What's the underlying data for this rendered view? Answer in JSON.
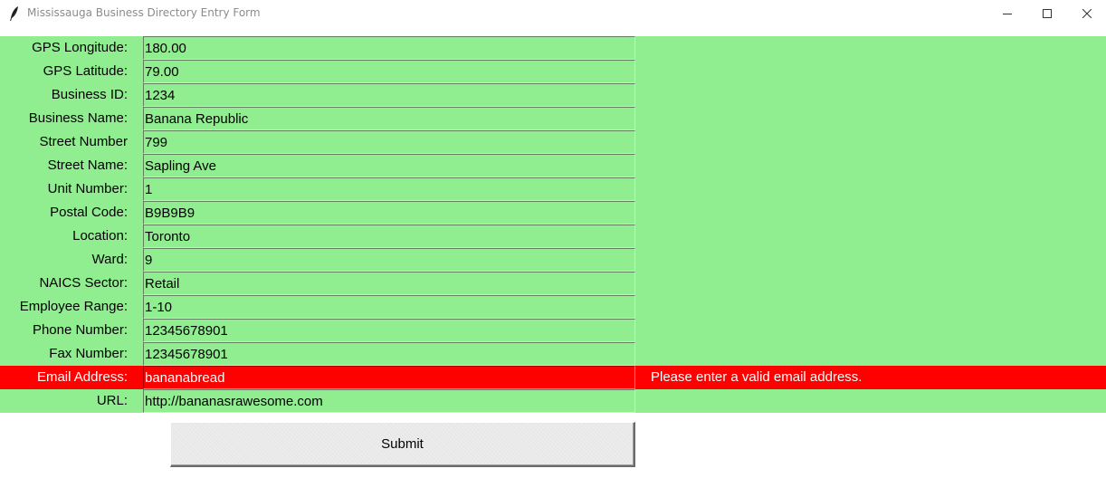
{
  "window": {
    "title": "Mississauga Business Directory Entry Form",
    "icon": "feather-icon",
    "controls": [
      "minimize-icon",
      "maximize-icon",
      "close-icon"
    ]
  },
  "colors": {
    "form_background": "#90ee90",
    "error_background": "#ff0000",
    "error_text": "#ffffff"
  },
  "fields": [
    {
      "label": "GPS Longitude:",
      "value": "180.00"
    },
    {
      "label": "GPS Latitude:",
      "value": "79.00"
    },
    {
      "label": "Business ID:",
      "value": "1234"
    },
    {
      "label": "Business Name:",
      "value": "Banana Republic"
    },
    {
      "label": "Street Number",
      "value": "799"
    },
    {
      "label": "Street Name:",
      "value": "Sapling Ave"
    },
    {
      "label": "Unit Number:",
      "value": "1"
    },
    {
      "label": "Postal Code:",
      "value": "B9B9B9"
    },
    {
      "label": "Location:",
      "value": "Toronto"
    },
    {
      "label": "Ward:",
      "value": "9"
    },
    {
      "label": "NAICS Sector:",
      "value": "Retail"
    },
    {
      "label": "Employee Range:",
      "value": "1-10"
    },
    {
      "label": "Phone Number:",
      "value": "12345678901"
    },
    {
      "label": "Fax Number:",
      "value": "12345678901"
    },
    {
      "label": "Email Address:",
      "value": "bananabread",
      "error": "Please enter a valid email address."
    },
    {
      "label": "URL:",
      "value": "http://bananasrawesome.com"
    }
  ],
  "submit_label": "Submit"
}
